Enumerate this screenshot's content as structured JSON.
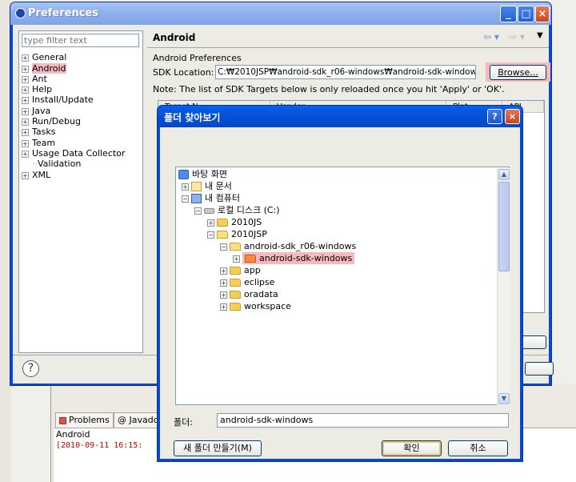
{
  "background": {
    "tabs": [
      {
        "label": "Problems"
      },
      {
        "label": "Javado"
      }
    ],
    "console": {
      "header": "Android",
      "line": "[2010-09-11 16:15:"
    }
  },
  "preferences": {
    "title": "Preferences",
    "filter_placeholder": "type filter text",
    "tree": [
      {
        "label": "General",
        "expandable": true
      },
      {
        "label": "Android",
        "expandable": true,
        "highlighted": true
      },
      {
        "label": "Ant",
        "expandable": true
      },
      {
        "label": "Help",
        "expandable": true
      },
      {
        "label": "Install/Update",
        "expandable": true
      },
      {
        "label": "Java",
        "expandable": true
      },
      {
        "label": "Run/Debug",
        "expandable": true
      },
      {
        "label": "Tasks",
        "expandable": true
      },
      {
        "label": "Team",
        "expandable": true
      },
      {
        "label": "Usage Data Collector",
        "expandable": true
      },
      {
        "label": "Validation",
        "expandable": false
      },
      {
        "label": "XML",
        "expandable": true
      }
    ],
    "page_title": "Android",
    "page_subtitle": "Android Preferences",
    "sdk_label": "SDK Location:",
    "sdk_value": "C:₩2010JSP₩android-sdk_r06-windows₩android-sdk-windows",
    "browse_label": "Browse...",
    "note": "Note: The list of SDK Targets below is only reloaded once you hit 'Apply' or 'OK'.",
    "table_headers": [
      "Target N",
      "Vendor",
      "Plat",
      "API"
    ]
  },
  "folder_dialog": {
    "title": "폴더 찾아보기",
    "tree": [
      {
        "label": "바탕 화면",
        "level": 0,
        "toggle": "",
        "icon": "desktop-icon"
      },
      {
        "label": "내 문서",
        "level": 1,
        "toggle": "+",
        "icon": "documents-icon"
      },
      {
        "label": "내 컴퓨터",
        "level": 1,
        "toggle": "−",
        "icon": "computer-icon"
      },
      {
        "label": "로컬 디스크 (C:)",
        "level": 2,
        "toggle": "−",
        "icon": "drive-icon"
      },
      {
        "label": "2010JS",
        "level": 3,
        "toggle": "+",
        "icon": "folder-icon"
      },
      {
        "label": "2010JSP",
        "level": 3,
        "toggle": "−",
        "icon": "folder-open-icon"
      },
      {
        "label": "android-sdk_r06-windows",
        "level": 4,
        "toggle": "−",
        "icon": "folder-open-icon"
      },
      {
        "label": "android-sdk-windows",
        "level": 5,
        "toggle": "+",
        "icon": "folder-selected-icon",
        "selected": true
      },
      {
        "label": "app",
        "level": 4,
        "toggle": "+",
        "icon": "folder-icon"
      },
      {
        "label": "eclipse",
        "level": 4,
        "toggle": "+",
        "icon": "folder-icon"
      },
      {
        "label": "oradata",
        "level": 4,
        "toggle": "+",
        "icon": "folder-icon"
      },
      {
        "label": "workspace",
        "level": 4,
        "toggle": "+",
        "icon": "folder-icon"
      }
    ],
    "folder_label": "폴더:",
    "folder_value": "android-sdk-windows",
    "new_folder_label": "새 폴더 만들기(M)",
    "ok_label": "확인",
    "cancel_label": "취소"
  },
  "colors": {
    "highlight": "#f6b9bd",
    "title_bar_active": "#0450d6",
    "title_bar_inactive": "#8eb1ec",
    "console_text": "#c00000"
  }
}
